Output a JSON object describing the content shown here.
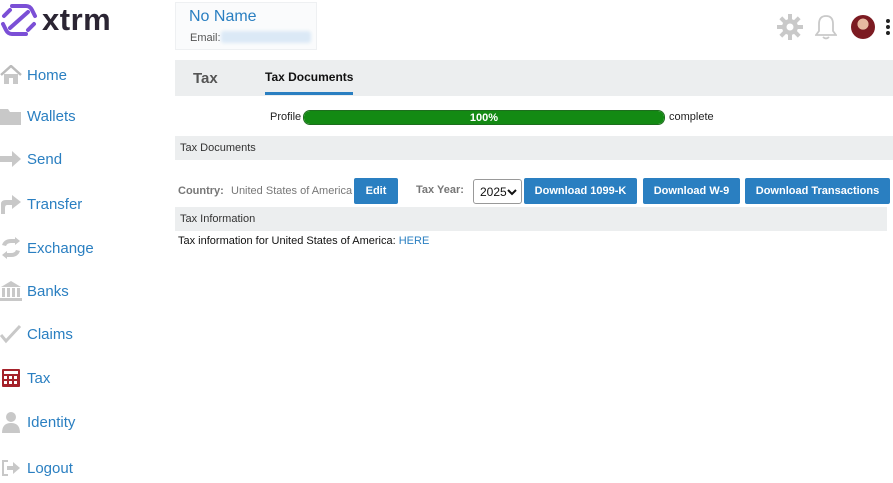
{
  "brand": {
    "name": "xtrm",
    "accent": "#7b4fd6"
  },
  "sidebar": {
    "items": [
      {
        "label": "Home",
        "icon": "home-icon"
      },
      {
        "label": "Wallets",
        "icon": "folder-icon"
      },
      {
        "label": "Send",
        "icon": "arrow-right-icon"
      },
      {
        "label": "Transfer",
        "icon": "transfer-icon"
      },
      {
        "label": "Exchange",
        "icon": "exchange-icon"
      },
      {
        "label": "Banks",
        "icon": "bank-icon"
      },
      {
        "label": "Claims",
        "icon": "check-icon"
      },
      {
        "label": "Tax",
        "icon": "calculator-icon",
        "active": true
      },
      {
        "label": "Identity",
        "icon": "user-icon"
      },
      {
        "label": "Logout",
        "icon": "logout-icon"
      }
    ]
  },
  "header": {
    "profile_name": "No Name",
    "email_label": "Email:",
    "icons": [
      "gear-icon",
      "bell-icon",
      "avatar",
      "kebab-menu-icon"
    ]
  },
  "tabs": [
    {
      "label": "Tax",
      "active": false
    },
    {
      "label": "Tax Documents",
      "active": true
    }
  ],
  "progress": {
    "label": "Profile",
    "value": 1.0,
    "text": "100%",
    "suffix": "complete",
    "color": "#138a13"
  },
  "tax_documents": {
    "section_title": "Tax Documents",
    "country_label": "Country:",
    "country_value": "United States of America",
    "edit_label": "Edit",
    "tax_year_label": "Tax Year:",
    "tax_year_value": "2025",
    "buttons": {
      "download_1099k": "Download 1099-K",
      "download_w9": "Download W-9",
      "download_transactions": "Download Transactions"
    }
  },
  "tax_information": {
    "section_title": "Tax Information",
    "text": "Tax information for United States of America: ",
    "link_label": "HERE"
  }
}
